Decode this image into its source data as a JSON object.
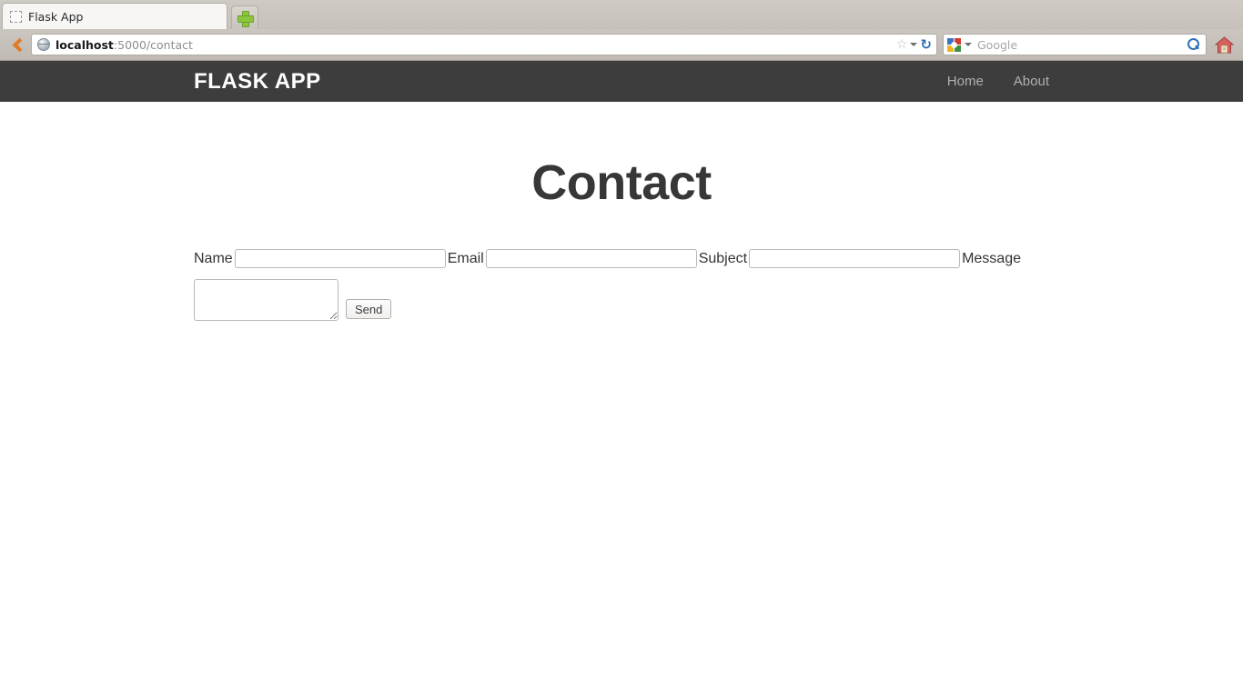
{
  "browser": {
    "tab": {
      "title": "Flask App",
      "favicon_icon": "dotted-placeholder-favicon"
    },
    "new_tab_icon": "plus-icon",
    "back_icon": "chevron-left-icon",
    "url": {
      "favicon_icon": "globe-icon",
      "host": "localhost",
      "path": ":5000/contact",
      "bookmark_icon": "star-icon",
      "dropdown_icon": "chevron-down-icon",
      "reload_icon": "reload-icon"
    },
    "search": {
      "engine_icon": "google-g-icon",
      "dropdown_icon": "chevron-down-icon",
      "placeholder": "Google",
      "go_icon": "magnifier-icon"
    },
    "home_icon": "home-house-icon"
  },
  "site": {
    "navbar": {
      "brand": "FLASK APP",
      "links": [
        {
          "label": "Home"
        },
        {
          "label": "About"
        }
      ]
    },
    "heading": "Contact",
    "form": {
      "fields": [
        {
          "label": "Name",
          "value": "",
          "placeholder": ""
        },
        {
          "label": "Email",
          "value": "",
          "placeholder": ""
        },
        {
          "label": "Subject",
          "value": "",
          "placeholder": ""
        }
      ],
      "message_label": "Message",
      "message_value": "",
      "message_placeholder": "",
      "submit_label": "Send"
    }
  },
  "colors": {
    "navbar_bg": "#3d3d3d",
    "navbar_brand": "#ffffff",
    "navbar_link": "#b0b0b0",
    "heading": "#373737",
    "page_bg": "#ffffff",
    "chrome_bg": "#c6c1ba",
    "back_arrow": "#e07b28",
    "new_tab_plus": "#8cc63f",
    "reload_blue": "#2f6fb5",
    "home_red": "#c9494a"
  }
}
